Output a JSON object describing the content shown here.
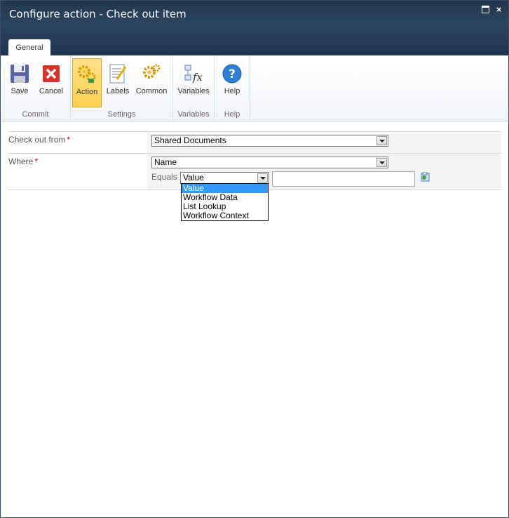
{
  "window": {
    "title": "Configure action - Check out item"
  },
  "tabs": [
    {
      "label": "General"
    }
  ],
  "ribbon": {
    "groups": [
      {
        "label": "Commit",
        "buttons": [
          {
            "label": "Save",
            "icon": "save-icon"
          },
          {
            "label": "Cancel",
            "icon": "cancel-icon"
          }
        ]
      },
      {
        "label": "Settings",
        "buttons": [
          {
            "label": "Action",
            "icon": "action-gear-icon",
            "selected": true
          },
          {
            "label": "Labels",
            "icon": "labels-icon"
          },
          {
            "label": "Common",
            "icon": "common-gear-icon"
          }
        ]
      },
      {
        "label": "Variables",
        "buttons": [
          {
            "label": "Variables",
            "icon": "variables-fx-icon"
          }
        ]
      },
      {
        "label": "Help",
        "buttons": [
          {
            "label": "Help",
            "icon": "help-icon"
          }
        ]
      }
    ]
  },
  "form": {
    "checkout_from": {
      "label": "Check out from",
      "required_mark": "*",
      "value": "Shared Documents"
    },
    "where": {
      "label": "Where",
      "required_mark": "*",
      "field_value": "Name",
      "operator_label": "Equals",
      "source_value": "Value",
      "text_value": "",
      "source_options": [
        "Value",
        "Workflow Data",
        "List Lookup",
        "Workflow Context"
      ],
      "selected_option": "Value"
    }
  },
  "colors": {
    "titlebar": "#2b4560",
    "selected_button": "#ffd04f",
    "required": "#bf0000",
    "highlight": "#3399ff"
  }
}
